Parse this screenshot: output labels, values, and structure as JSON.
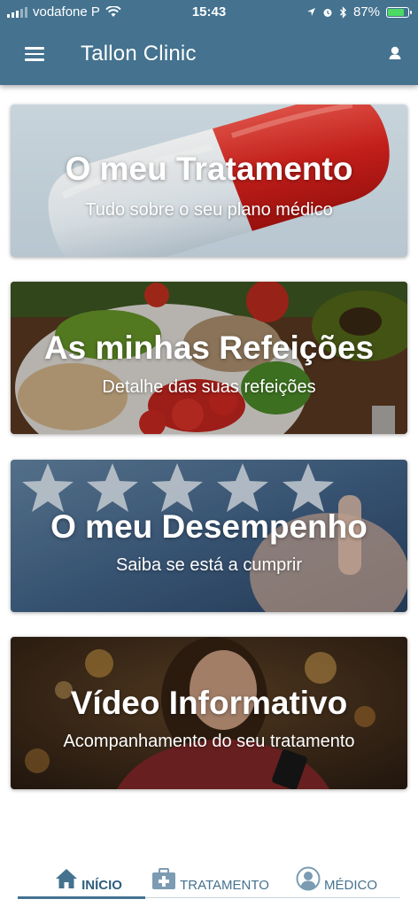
{
  "status_bar": {
    "carrier": "vodafone P",
    "time": "15:43",
    "battery": "87%",
    "battery_level": 0.87,
    "icons": [
      "signal-icon",
      "wifi-icon",
      "location-icon",
      "alarm-icon",
      "bluetooth-icon",
      "battery-icon"
    ]
  },
  "header": {
    "title": "Tallon Clinic",
    "menu_icon": "hamburger-menu-icon",
    "user_icon": "user-icon",
    "color": "#44728f"
  },
  "cards": [
    {
      "title": "O meu Tratamento",
      "subtitle": "Tudo sobre o seu plano médico"
    },
    {
      "title": "As minhas Refeições",
      "subtitle": "Detalhe das suas refeições"
    },
    {
      "title": "O meu Desempenho",
      "subtitle": "Saiba se está a cumprir"
    },
    {
      "title": "Vídeo Informativo",
      "subtitle": "Acompanhamento do seu tratamento"
    }
  ],
  "tabs": [
    {
      "label": "INÍCIO",
      "icon": "home-icon",
      "active": true
    },
    {
      "label": "TRATAMENTO",
      "icon": "medical-kit-icon",
      "active": false
    },
    {
      "label": "MÉDICO",
      "icon": "doctor-icon",
      "active": false
    }
  ],
  "colors": {
    "accent": "#44728f",
    "active_tab_text": "#2f5f7f"
  }
}
